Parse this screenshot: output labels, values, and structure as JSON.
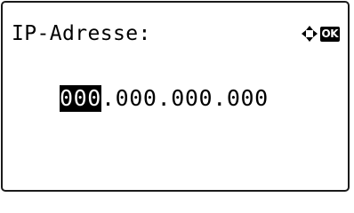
{
  "screen": {
    "title": "IP-Adresse:",
    "icons": {
      "navigation": "four-way-arrow-icon",
      "confirm": "ok-key-icon",
      "confirm_label": "OK"
    }
  },
  "ip_address": {
    "octets": [
      "000",
      "000",
      "000",
      "000"
    ],
    "separator": ".",
    "active_octet_index": 0
  },
  "colors": {
    "foreground": "#000000",
    "background": "#ffffff",
    "highlight_bg": "#000000",
    "highlight_fg": "#ffffff"
  }
}
